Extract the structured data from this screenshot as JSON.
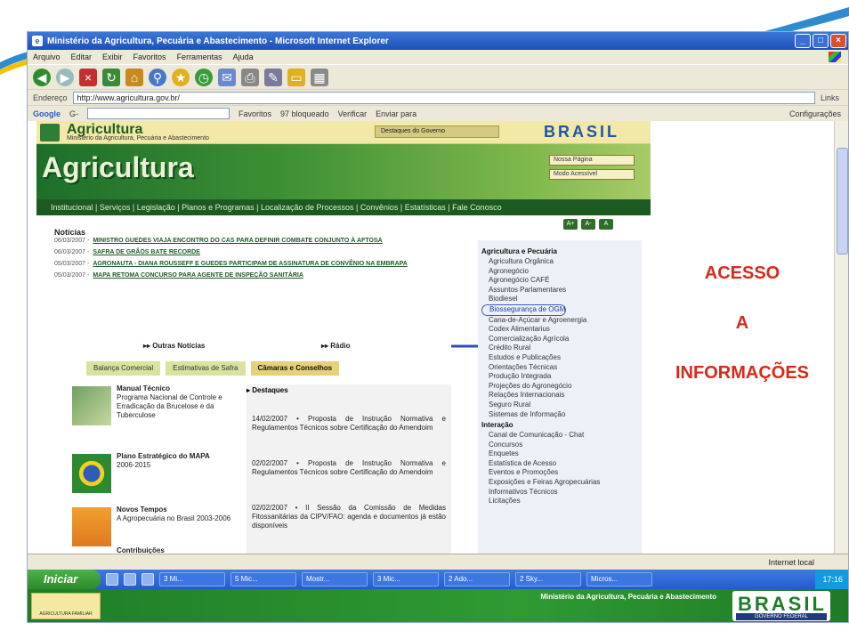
{
  "window": {
    "title": "Ministério da Agricultura, Pecuária e Abastecimento - Microsoft Internet Explorer"
  },
  "menubar": [
    "Arquivo",
    "Editar",
    "Exibir",
    "Favoritos",
    "Ferramentas",
    "Ajuda"
  ],
  "address": {
    "label": "Endereço",
    "url": "http://www.agricultura.gov.br/",
    "go": "Links"
  },
  "googlebar": {
    "logo": "Google",
    "prefix": "G-",
    "items": [
      "Favoritos",
      "97 bloqueado",
      "Verificar",
      "Enviar para"
    ],
    "config": "Configurações"
  },
  "page": {
    "brand": "Agricultura",
    "brand_sub": "Ministério da Agricultura, Pecuária e Abastecimento",
    "select": "Destaques do Governo",
    "brasil": "BRASIL",
    "banner": "Agricultura",
    "btn_home": "Nossa Página",
    "btn_access": "Modo Acessível",
    "nav": "Institucional | Serviços | Legislação | Planos e Programas | Localização de Processos | Convênios | Estatísticas | Fale Conosco",
    "font_btns": [
      "A+",
      "A-",
      "A"
    ],
    "news_title": "Notícias",
    "news": [
      {
        "date": "06/03/2007 -",
        "text": "Ministro Guedes viaja encontro do CAS para definir combate conjunto à aftosa"
      },
      {
        "date": "06/03/2007 -",
        "text": "Safra de grãos bate recorde"
      },
      {
        "date": "05/03/2007 -",
        "text": "Agronauta - Diana Rousseff e Guedes participam de assinatura de convênio na Embrapa"
      },
      {
        "date": "05/03/2007 -",
        "text": "Mapa retoma concurso para agente de inspeção sanitária"
      }
    ],
    "more_news": "▸▸ Outras Notícias",
    "radio": "▸▸ Rádio",
    "tabs": [
      "Balança Comercial",
      "Estimativas de Safra",
      "Câmaras e Conselhos"
    ],
    "features": [
      {
        "title": "Manual Técnico",
        "body": "Programa Nacional de Controle e Erradicação da Brucelose e da Tuberculose"
      },
      {
        "title": "Plano Estratégico do MAPA",
        "body": "2006-2015"
      },
      {
        "title": "Novos Tempos",
        "body": "A Agropecuária no Brasil 2003-2006"
      },
      {
        "title": "Contribuições",
        "body": ""
      }
    ],
    "dest_title": "▸ Destaques",
    "dest": [
      "14/02/2007 • Proposta de Instrução Normativa e Regulamentos Técnicos sobre Certificação do Amendoim",
      "02/02/2007 • Proposta de Instrução Normativa e Regulamentos Técnicos sobre Certificação do Amendoim",
      "02/02/2007 • II Sessão da Comissão de Medidas Fitossanitárias da CIPV/FAO: agenda e documentos já estão disponíveis"
    ],
    "right_hdr1": "Agricultura e Pecuária",
    "right_items1": [
      "Agricultura Orgânica",
      "Agronegócio",
      "Agronegócio CAFÉ",
      "Assuntos Parlamentares",
      "Biodiesel",
      "Biossegurança de OGM",
      "Cana-de-Açúcar e Agroenergia",
      "Codex Alimentarius",
      "Comercialização Agrícola",
      "Crédito Rural",
      "Estudos e Publicações",
      "Orientações Técnicas",
      "Produção Integrada",
      "Projeções do Agronegócio",
      "Relações Internacionais",
      "Seguro Rural",
      "Sistemas de Informação"
    ],
    "right_hdr2": "Interação",
    "right_items2": [
      "Canal de Comunicação - Chat",
      "Concursos",
      "Enquetes",
      "Estatística de Acesso",
      "Eventos e Promoções",
      "Exposições e Feiras Agropecuárias",
      "Informativos Técnicos",
      "Licitações"
    ]
  },
  "overlay": {
    "line1": "ACESSO",
    "line2": "A",
    "line3": "INFORMAÇÕES"
  },
  "status": {
    "zone": "Internet local"
  },
  "taskbar": {
    "start": "Iniciar",
    "tasks": [
      "3 Mi...",
      "5 Mic...",
      "Mostr...",
      "3 Mic...",
      "2 Ado...",
      "2 Sky...",
      "Micros..."
    ],
    "clock": "17:16"
  },
  "footer": {
    "ministry": "Ministério da Agricultura, Pecuária e Abastecimento",
    "brasil": "BRASIL",
    "gov": "GOVERNO FEDERAL",
    "logo_text": "AGRICULTURA FAMILIAR"
  },
  "colors": {
    "accent_green": "#1c5a22",
    "overlay_red": "#d62a1c",
    "xp_blue": "#245cd0"
  }
}
